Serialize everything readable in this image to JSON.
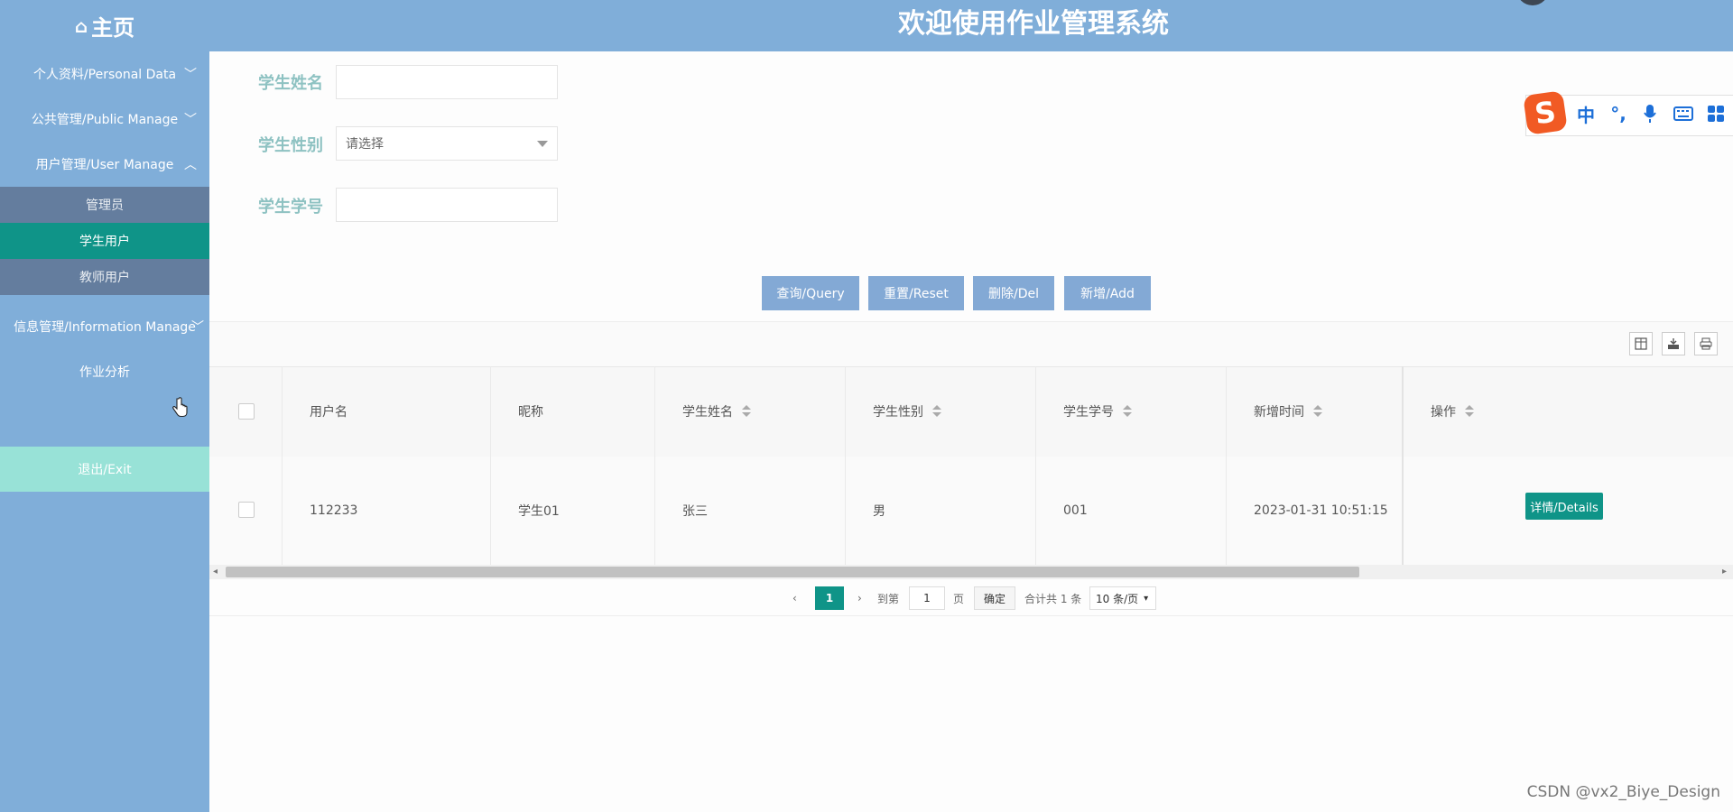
{
  "header": {
    "home_icon": "home-icon",
    "home_label": "主页",
    "title": "欢迎使用作业管理系统"
  },
  "sidebar": {
    "items": [
      {
        "label": "个人资料/Personal Data",
        "chevron": "chevron-down-icon"
      },
      {
        "label": "公共管理/Public Manage",
        "chevron": "chevron-down-icon"
      },
      {
        "label": "用户管理/User Manage",
        "chevron": "chevron-up-icon"
      },
      {
        "label": "信息管理/Information Manage",
        "chevron": "chevron-down-icon"
      },
      {
        "label": "作业分析"
      }
    ],
    "submenu": [
      {
        "label": "管理员"
      },
      {
        "label": "学生用户",
        "active": true
      },
      {
        "label": "教师用户"
      }
    ],
    "exit_label": "退出/Exit"
  },
  "form": {
    "name_label": "学生姓名",
    "name_value": "",
    "gender_label": "学生性别",
    "gender_placeholder": "请选择",
    "id_label": "学生学号",
    "id_value": ""
  },
  "buttons": {
    "query": "查询/Query",
    "reset": "重置/Reset",
    "delete": "删除/Del",
    "add": "新增/Add"
  },
  "ime": {
    "logo": "S",
    "lang": "中",
    "punct": "°,",
    "mic_icon": "microphone-icon",
    "keyboard_icon": "keyboard-icon",
    "grid_icon": "grid-icon"
  },
  "table_tools": [
    "columns-icon",
    "export-icon",
    "print-icon"
  ],
  "table": {
    "headers": [
      "用户名",
      "昵称",
      "学生姓名",
      "学生性别",
      "学生学号",
      "新增时间",
      "操作"
    ],
    "rows": [
      {
        "username": "112233",
        "nickname": "学生01",
        "name": "张三",
        "gender": "男",
        "student_no": "001",
        "created": "2023-01-31 10:51:15",
        "action": "详情/Details"
      }
    ]
  },
  "pagination": {
    "current_page": "1",
    "goto_label": "到第",
    "goto_value": "1",
    "page_unit": "页",
    "confirm": "确定",
    "total": "合计共 1 条",
    "page_size": "10 条/页"
  },
  "watermark": "CSDN @vx2_Biye_Design"
}
